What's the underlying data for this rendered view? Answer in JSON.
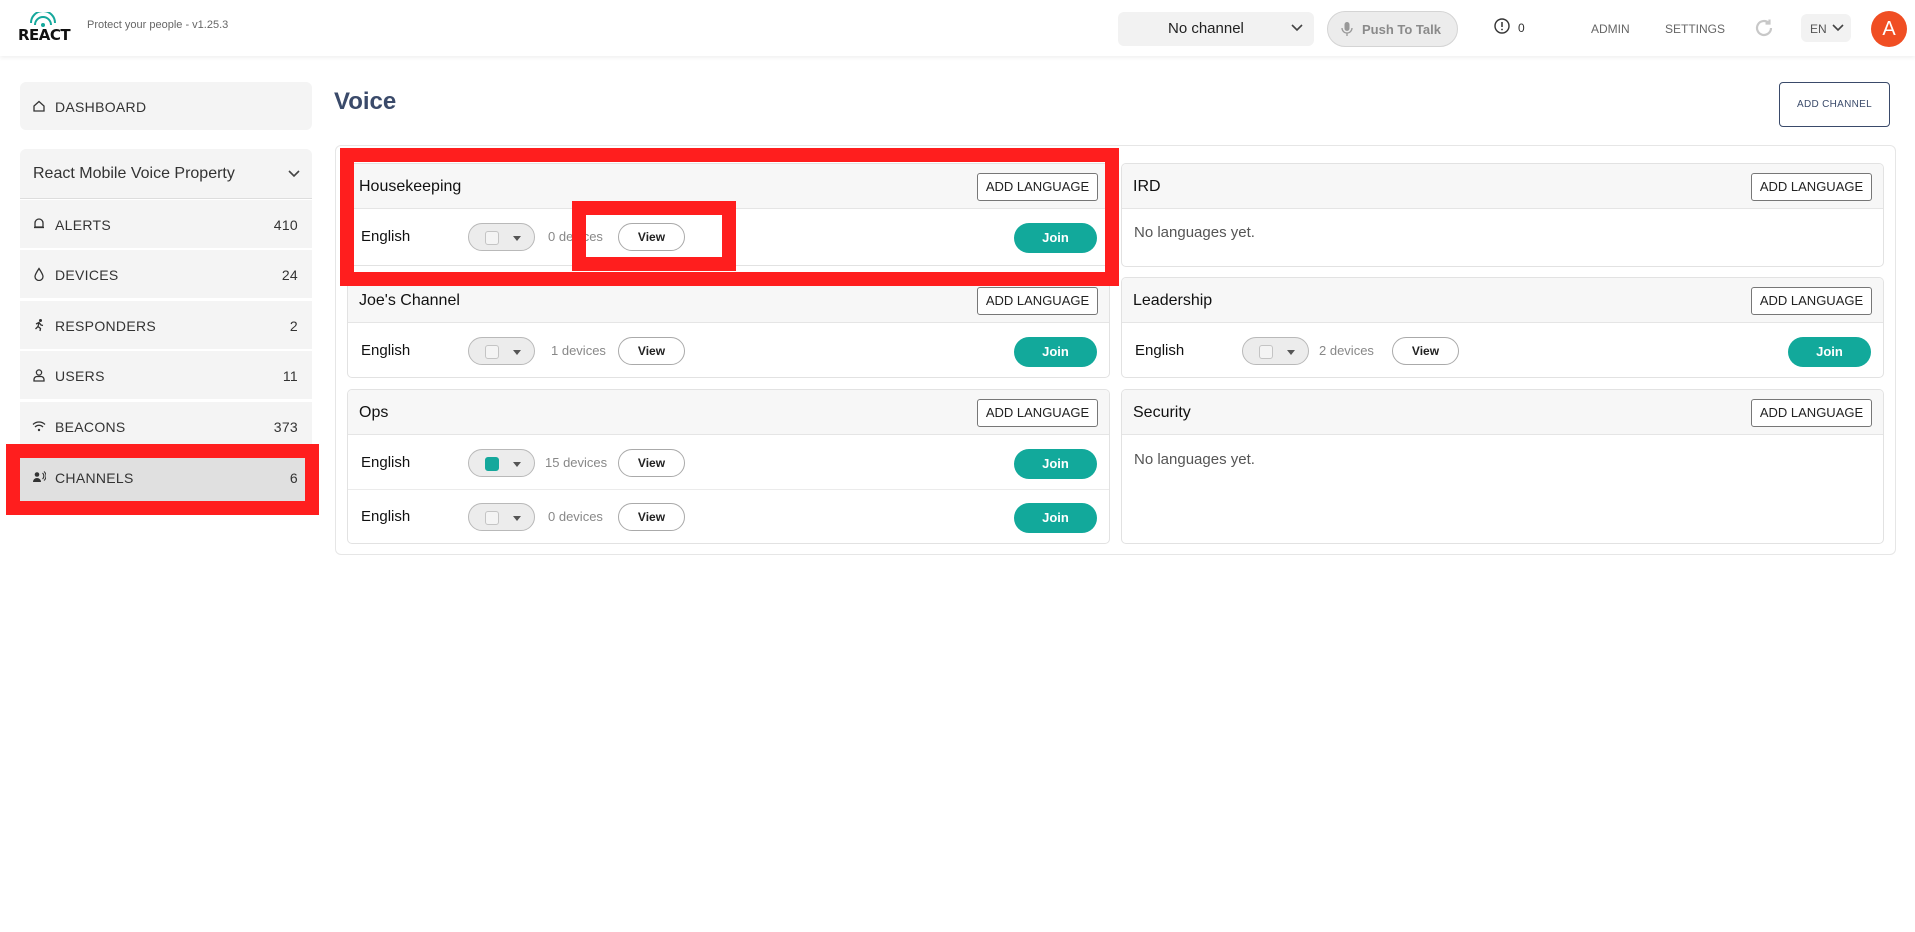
{
  "app": {
    "logo_text": "REACT",
    "tagline": "Protect your people - v1.25.3"
  },
  "header": {
    "channel_select_value": "No channel",
    "push_to_talk_label": "Push To Talk",
    "alert_count": "0",
    "admin_label": "ADMIN",
    "settings_label": "SETTINGS",
    "language_value": "EN",
    "avatar_initial": "A"
  },
  "sidebar": {
    "dashboard_label": "DASHBOARD",
    "property_name": "React Mobile Voice Property",
    "items": [
      {
        "label": "ALERTS",
        "count": "410",
        "icon": "bell-icon"
      },
      {
        "label": "DEVICES",
        "count": "24",
        "icon": "drop-icon"
      },
      {
        "label": "RESPONDERS",
        "count": "2",
        "icon": "runner-icon"
      },
      {
        "label": "USERS",
        "count": "11",
        "icon": "user-icon"
      },
      {
        "label": "BEACONS",
        "count": "373",
        "icon": "wifi-icon"
      },
      {
        "label": "CHANNELS",
        "count": "6",
        "icon": "speaker-person-icon"
      }
    ]
  },
  "main": {
    "title": "Voice",
    "add_channel_label": "ADD CHANNEL",
    "add_language_label": "ADD LANGUAGE",
    "view_label": "View",
    "join_label": "Join",
    "empty_label": "No languages yet.",
    "accent_color": "#12a99b",
    "channels": [
      {
        "name": "Housekeeping",
        "languages": [
          {
            "language": "English",
            "devices": "0 devices",
            "selected": false
          }
        ]
      },
      {
        "name": "IRD",
        "languages": []
      },
      {
        "name": "Joe's Channel",
        "languages": [
          {
            "language": "English",
            "devices": "1 devices",
            "selected": false
          }
        ]
      },
      {
        "name": "Leadership",
        "languages": [
          {
            "language": "English",
            "devices": "2 devices",
            "selected": false
          }
        ]
      },
      {
        "name": "Ops",
        "languages": [
          {
            "language": "English",
            "devices": "15 devices",
            "selected": true
          },
          {
            "language": "English",
            "devices": "0 devices",
            "selected": false
          }
        ]
      },
      {
        "name": "Security",
        "languages": []
      }
    ]
  }
}
